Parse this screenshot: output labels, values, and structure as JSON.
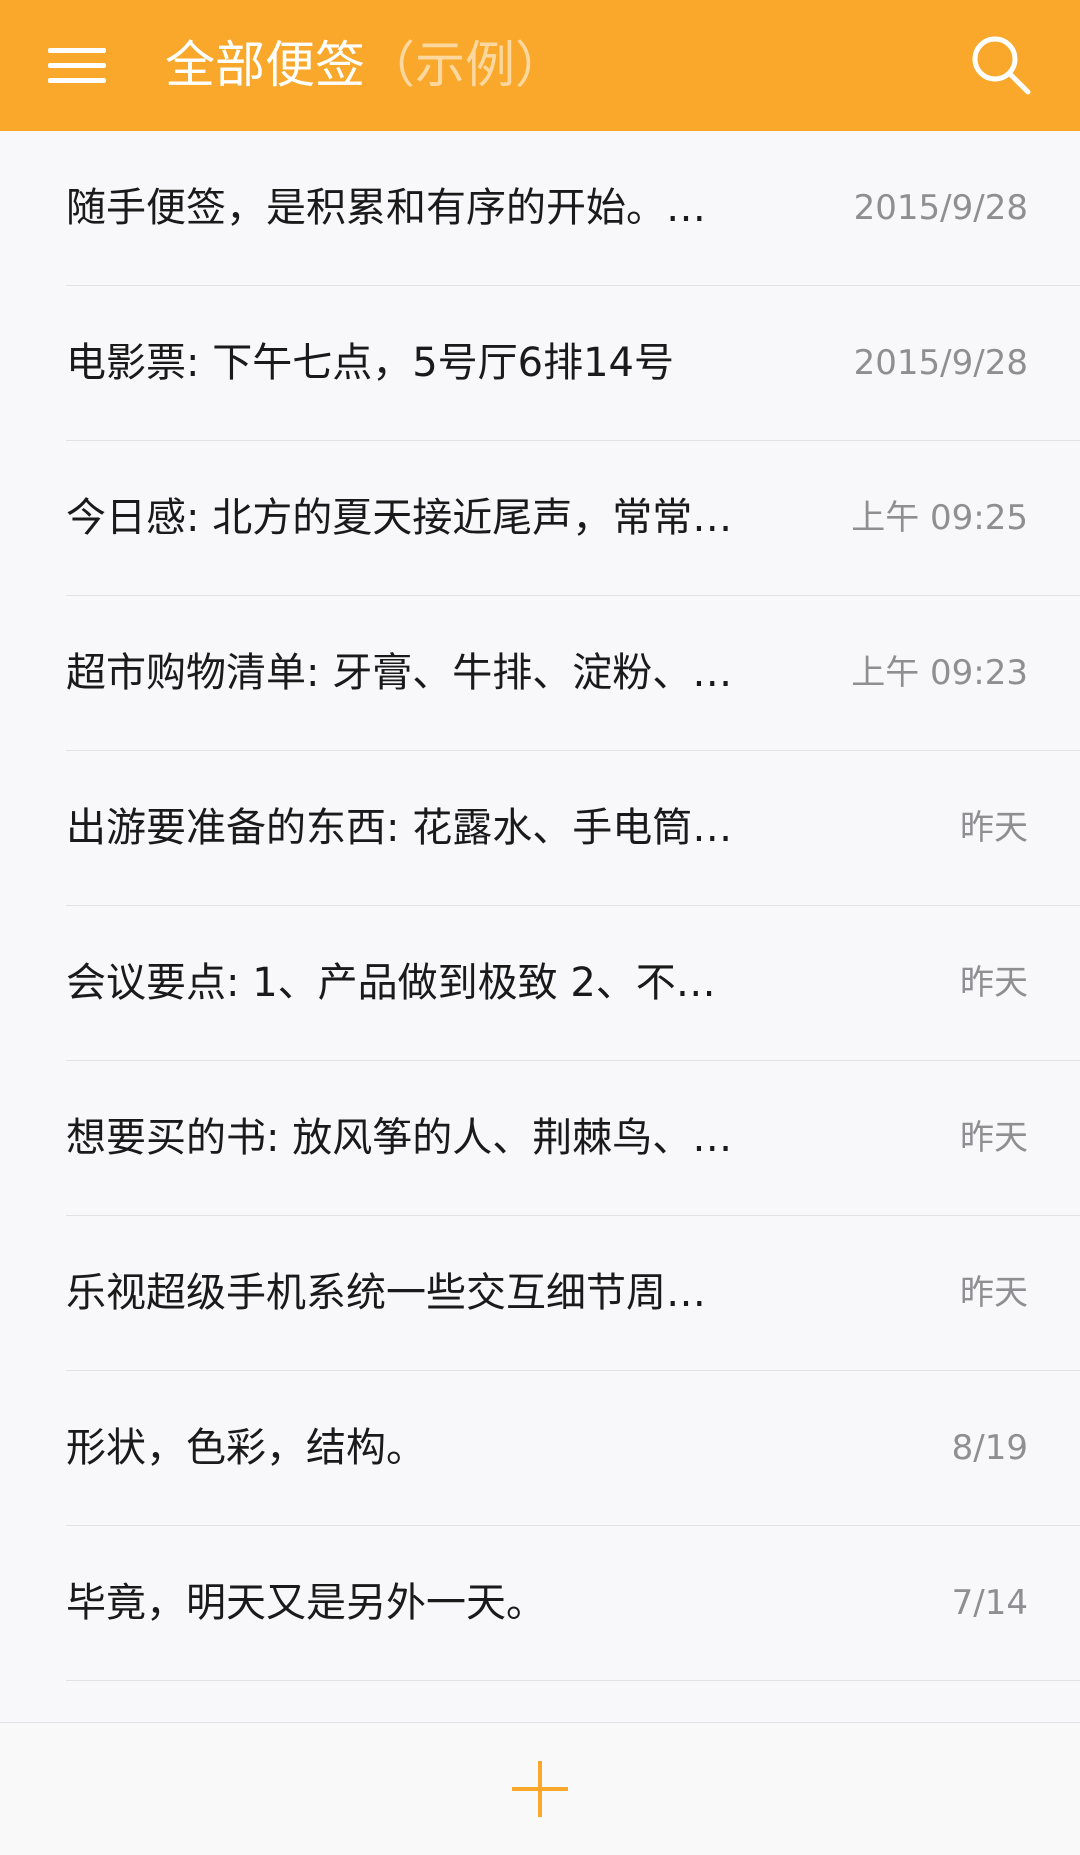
{
  "header": {
    "title": "全部便签",
    "title_suffix": "（示例）",
    "background_color": "#F9A82B"
  },
  "icons": {
    "menu": "hamburger-menu-icon",
    "search": "search-icon",
    "add": "plus-icon"
  },
  "notes": [
    {
      "text": "随手便签，是积累和有序的开始。…",
      "date": "2015/9/28"
    },
    {
      "text": "电影票: 下午七点，5号厅6排14号",
      "date": "2015/9/28"
    },
    {
      "text": "今日感: 北方的夏天接近尾声，常常…",
      "date": "上午 09:25"
    },
    {
      "text": "超市购物清单: 牙膏、牛排、淀粉、…",
      "date": "上午 09:23"
    },
    {
      "text": "出游要准备的东西: 花露水、手电筒…",
      "date": "昨天"
    },
    {
      "text": "会议要点: 1、产品做到极致  2、不…",
      "date": "昨天"
    },
    {
      "text": "想要买的书: 放风筝的人、荆棘鸟、…",
      "date": "昨天"
    },
    {
      "text": "乐视超级手机系统一些交互细节周…",
      "date": "昨天"
    },
    {
      "text": "形状，色彩，结构。",
      "date": "8/19"
    },
    {
      "text": "毕竟，明天又是另外一天。",
      "date": "7/14"
    }
  ]
}
